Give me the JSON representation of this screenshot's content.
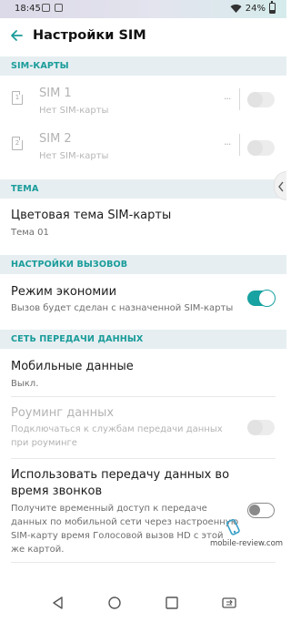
{
  "status_bar": {
    "time": "18:45",
    "battery": "24%"
  },
  "app_bar": {
    "title": "Настройки SIM"
  },
  "sections": {
    "sim_cards": "SIM-КАРТЫ",
    "theme": "ТЕМА",
    "call_settings": "НАСТРОЙКИ ВЫЗОВОВ",
    "data_network": "СЕТЬ ПЕРЕДАЧИ ДАННЫХ"
  },
  "sims": [
    {
      "slot": "1",
      "name": "SIM 1",
      "status": "Нет SIM-карты",
      "more": "...",
      "enabled": false
    },
    {
      "slot": "2",
      "name": "SIM 2",
      "status": "Нет SIM-карты",
      "more": "...",
      "enabled": false
    }
  ],
  "theme": {
    "title": "Цветовая тема SIM-карты",
    "value": "Тема 01"
  },
  "economy": {
    "title": "Режим экономии",
    "subtitle": "Вызов будет сделан с назначенной SIM-карты",
    "enabled": true
  },
  "mobile_data": {
    "title": "Мобильные данные",
    "value": "Выкл."
  },
  "roaming": {
    "title": "Роуминг данных",
    "subtitle_line1": "Подключаться к службам передачи данных",
    "subtitle_line2": "при роуминге",
    "enabled": false
  },
  "data_during_calls": {
    "title_line1": "Использовать передачу данных во",
    "title_line2": "время звонков",
    "subtitle_line1": "Получите временный доступ к передаче",
    "subtitle_line2": "данных по мобильной сети через настроенную",
    "subtitle_line3": "SIM-карту время Голосовой вызов HD с этой",
    "subtitle_line4": "же картой.",
    "enabled": false
  },
  "watermark": "mobile-review.com",
  "colors": {
    "accent": "#18a2a1",
    "section_bg": "#e6eef1",
    "section_text": "#1a9c9a"
  },
  "icons": [
    "back-arrow-icon",
    "sim-card-icon",
    "chevron-left-icon",
    "nav-back-icon",
    "nav-home-icon",
    "nav-recents-icon",
    "nav-sim-switch-icon"
  ]
}
